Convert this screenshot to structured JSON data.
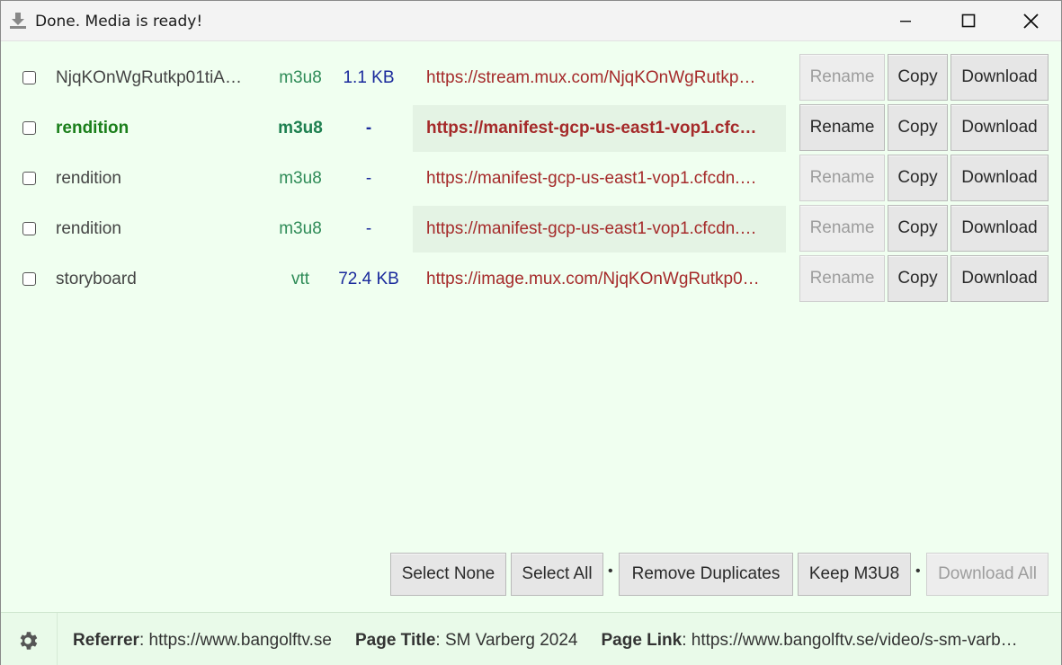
{
  "window": {
    "title": "Done. Media is ready!",
    "icon": "download-icon"
  },
  "rows": [
    {
      "name": "NjqKOnWgRutkp01tiA…",
      "ext": "m3u8",
      "size": "1.1 KB",
      "url": "https://stream.mux.com/NjqKOnWgRutkp…",
      "highlighted": false,
      "rename_enabled": false
    },
    {
      "name": "rendition",
      "ext": "m3u8",
      "size": "-",
      "url": "https://manifest-gcp-us-east1-vop1.cfc…",
      "highlighted": true,
      "rename_enabled": true
    },
    {
      "name": "rendition",
      "ext": "m3u8",
      "size": "-",
      "url": "https://manifest-gcp-us-east1-vop1.cfcdn.…",
      "highlighted": false,
      "rename_enabled": false
    },
    {
      "name": "rendition",
      "ext": "m3u8",
      "size": "-",
      "url": "https://manifest-gcp-us-east1-vop1.cfcdn.…",
      "highlighted": false,
      "rename_enabled": false
    },
    {
      "name": "storyboard",
      "ext": "vtt",
      "size": "72.4 KB",
      "url": "https://image.mux.com/NjqKOnWgRutkp0…",
      "highlighted": false,
      "rename_enabled": false
    }
  ],
  "row_buttons": {
    "rename": "Rename",
    "copy": "Copy",
    "download": "Download"
  },
  "actions": {
    "select_none": "Select None",
    "select_all": "Select All",
    "remove_duplicates": "Remove Duplicates",
    "keep_m3u8": "Keep M3U8",
    "download_all": "Download All",
    "separator": "•"
  },
  "footer": {
    "referrer_label": "Referrer",
    "referrer_value": "https://www.bangolftv.se",
    "page_title_label": "Page Title",
    "page_title_value": "SM Varberg 2024",
    "page_link_label": "Page Link",
    "page_link_value": "https://www.bangolftv.se/video/s-sm-varb…",
    "colon": ": "
  }
}
